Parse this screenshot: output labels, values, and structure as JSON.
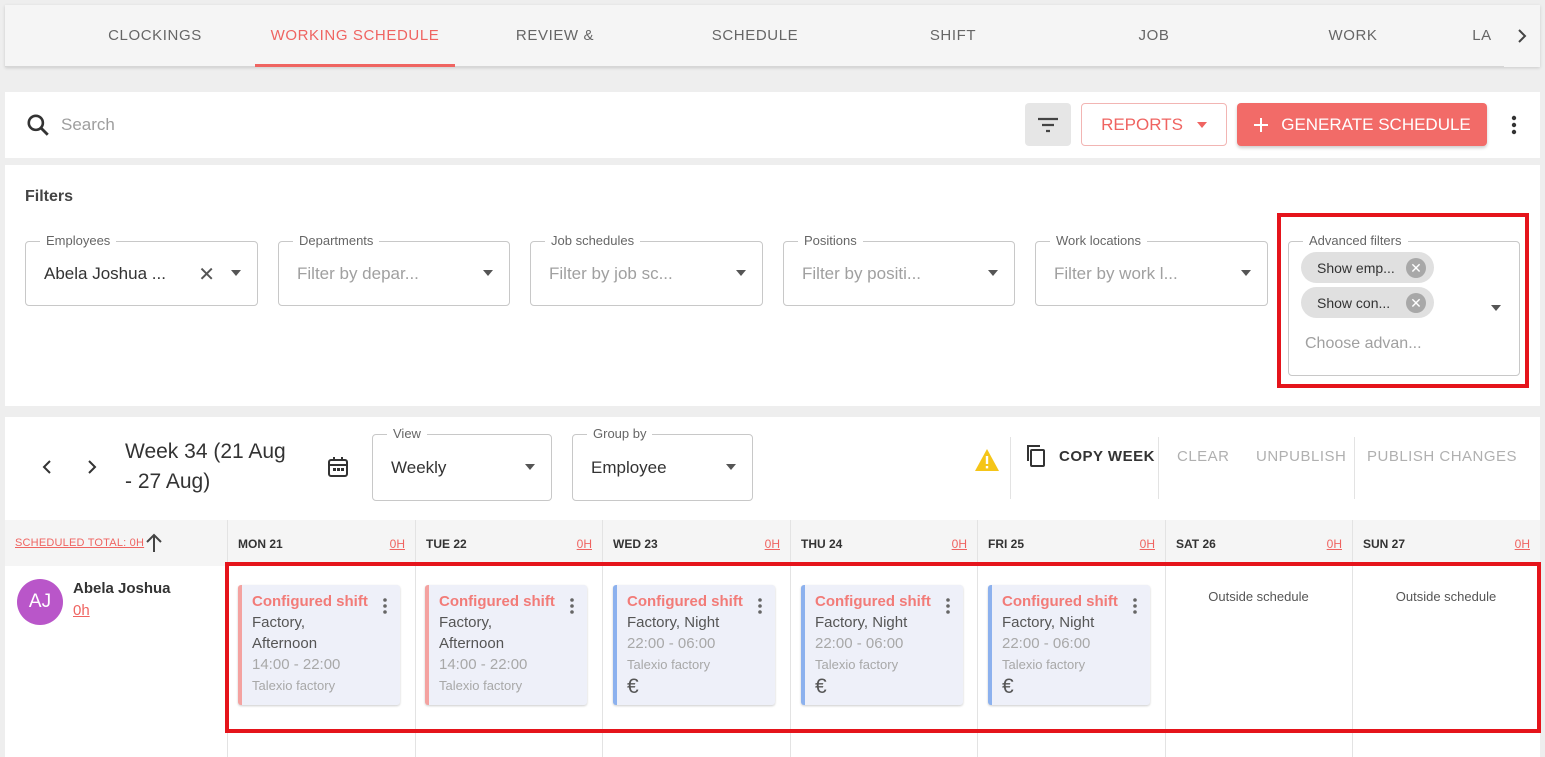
{
  "tabs": [
    {
      "label": "CLOCKINGS",
      "active": false
    },
    {
      "label": "WORKING SCHEDULE",
      "active": true
    },
    {
      "label": "REVIEW & APPROVE",
      "active": false
    },
    {
      "label": "SCHEDULE GENERATOR",
      "active": false
    },
    {
      "label": "SHIFT TEMPLATES",
      "active": false
    },
    {
      "label": "JOB SCHEDULES",
      "active": false
    },
    {
      "label": "WORK LOCATIONS",
      "active": false
    },
    {
      "label": "LA",
      "active": false
    }
  ],
  "search": {
    "placeholder": "Search",
    "value": ""
  },
  "toolbar": {
    "reports_label": "REPORTS",
    "generate_label": "GENERATE SCHEDULE"
  },
  "filters": {
    "title": "Filters",
    "employees": {
      "label": "Employees",
      "value": "Abela Joshua ..."
    },
    "departments": {
      "label": "Departments",
      "placeholder": "Filter by depar..."
    },
    "job_schedules": {
      "label": "Job schedules",
      "placeholder": "Filter by job sc..."
    },
    "positions": {
      "label": "Positions",
      "placeholder": "Filter by positi..."
    },
    "work_locations": {
      "label": "Work locations",
      "placeholder": "Filter by work l..."
    },
    "advanced": {
      "label": "Advanced filters",
      "chips": [
        "Show emp...",
        "Show con..."
      ],
      "placeholder": "Choose advan..."
    }
  },
  "schedule": {
    "week_title": "Week 34 (21 Aug - 27 Aug)",
    "view": {
      "label": "View",
      "value": "Weekly"
    },
    "group_by": {
      "label": "Group by",
      "value": "Employee"
    },
    "actions": {
      "copy_week": "COPY WEEK",
      "clear": "CLEAR",
      "unpublish": "UNPUBLISH",
      "publish_changes": "PUBLISH CHANGES"
    },
    "scheduled_total": "SCHEDULED TOTAL: 0H",
    "days": [
      {
        "day": "MON 21",
        "hours": "0H"
      },
      {
        "day": "TUE 22",
        "hours": "0H"
      },
      {
        "day": "WED 23",
        "hours": "0H"
      },
      {
        "day": "THU 24",
        "hours": "0H"
      },
      {
        "day": "FRI 25",
        "hours": "0H"
      },
      {
        "day": "SAT 26",
        "hours": "0H"
      },
      {
        "day": "SUN 27",
        "hours": "0H"
      }
    ],
    "employee": {
      "initials": "AJ",
      "name": "Abela Joshua",
      "hours": "0h"
    },
    "shifts": [
      {
        "title": "Configured shift",
        "line1": "Factory,",
        "line2": "Afternoon",
        "time": "14:00 - 22:00",
        "location": "Talexio factory",
        "currency": ""
      },
      {
        "title": "Configured shift",
        "line1": "Factory,",
        "line2": "Afternoon",
        "time": "14:00 - 22:00",
        "location": "Talexio factory",
        "currency": ""
      },
      {
        "title": "Configured shift",
        "line1": "Factory, Night",
        "line2": "",
        "time": "22:00 - 06:00",
        "location": "Talexio factory",
        "currency": "€"
      },
      {
        "title": "Configured shift",
        "line1": "Factory, Night",
        "line2": "",
        "time": "22:00 - 06:00",
        "location": "Talexio factory",
        "currency": "€"
      },
      {
        "title": "Configured shift",
        "line1": "Factory, Night",
        "line2": "",
        "time": "22:00 - 06:00",
        "location": "Talexio factory",
        "currency": "€"
      }
    ],
    "outside_label": "Outside schedule"
  },
  "colors": {
    "accent": "#ef6461",
    "highlight": "#e5141b",
    "avatar": "#b956c9",
    "warning": "#f5c518"
  }
}
